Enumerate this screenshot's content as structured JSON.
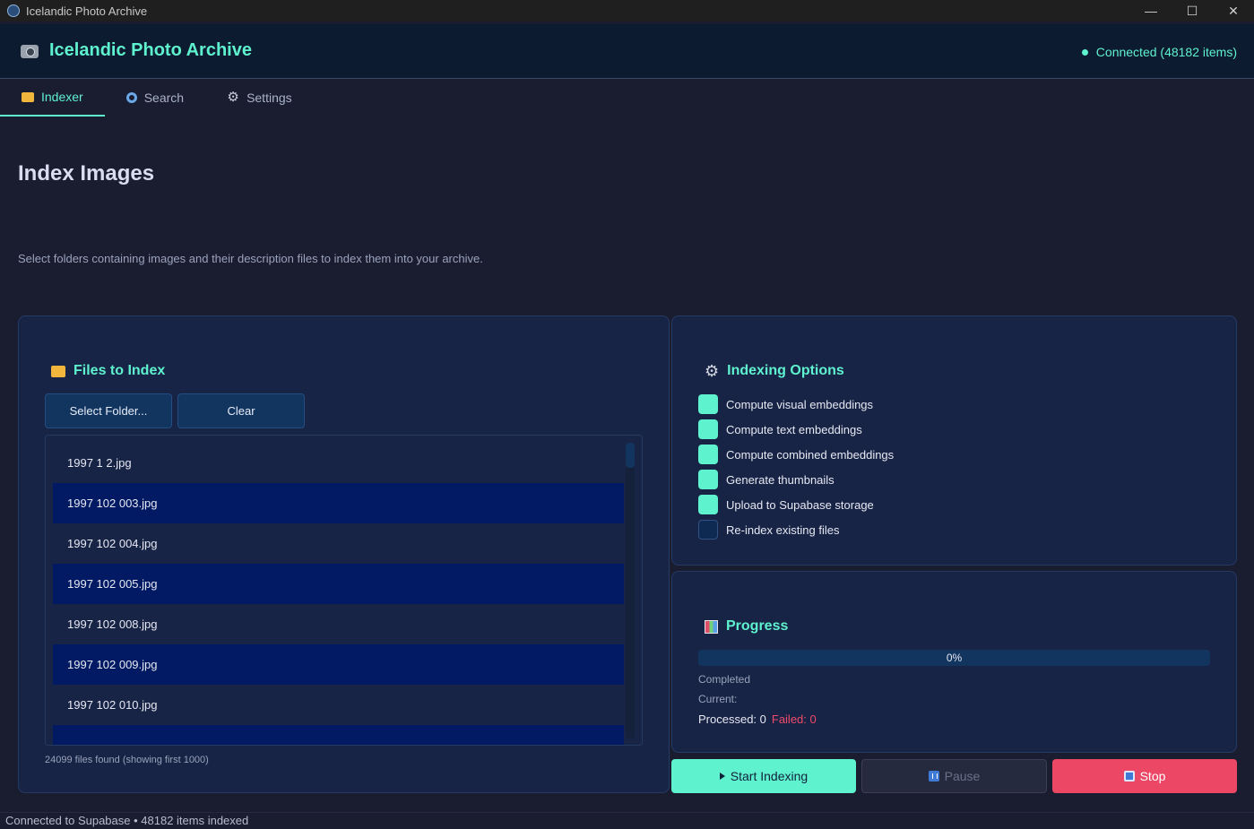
{
  "window": {
    "title": "Icelandic Photo Archive",
    "controls": {
      "minimize": "—",
      "maximize": "☐",
      "close": "✕"
    }
  },
  "header": {
    "title": "Icelandic Photo Archive",
    "status": "Connected (48182 items)",
    "icon": "camera-icon"
  },
  "tabs": [
    {
      "label": "Indexer",
      "icon": "folder-icon",
      "active": true
    },
    {
      "label": "Search",
      "icon": "magnifier-icon",
      "active": false
    },
    {
      "label": "Settings",
      "icon": "gear-icon",
      "active": false
    }
  ],
  "main": {
    "title": "Index Images",
    "description": "Select folders containing images and their description files to index them into your archive."
  },
  "files_panel": {
    "title": "Files to Index",
    "select_folder_label": "Select Folder...",
    "clear_label": "Clear",
    "files": [
      "1997 1 2.jpg",
      "1997 102 003.jpg",
      "1997 102 004.jpg",
      "1997 102 005.jpg",
      "1997 102 008.jpg",
      "1997 102 009.jpg",
      "1997 102 010.jpg",
      ""
    ],
    "count_text": "24099 files found (showing first 1000)"
  },
  "options_panel": {
    "title": "Indexing Options",
    "options": [
      {
        "label": "Compute visual embeddings",
        "checked": true
      },
      {
        "label": "Compute text embeddings",
        "checked": true
      },
      {
        "label": "Compute combined embeddings",
        "checked": true
      },
      {
        "label": "Generate thumbnails",
        "checked": true
      },
      {
        "label": "Upload to Supabase storage",
        "checked": true
      },
      {
        "label": "Re-index existing files",
        "checked": false
      }
    ]
  },
  "progress_panel": {
    "title": "Progress",
    "percent_text": "0%",
    "percent": 0,
    "completed_label": "Completed",
    "current_label": "Current:",
    "processed_text": "Processed: 0",
    "failed_text": "Failed: 0"
  },
  "actions": {
    "start_label": "Start Indexing",
    "pause_label": "Pause",
    "stop_label": "Stop"
  },
  "statusbar": {
    "text": "Connected to Supabase • 48182 items indexed"
  },
  "colors": {
    "accent": "#5ff2cf",
    "danger": "#ec4866",
    "panel": "#182446",
    "row_alt": "#011a63"
  }
}
